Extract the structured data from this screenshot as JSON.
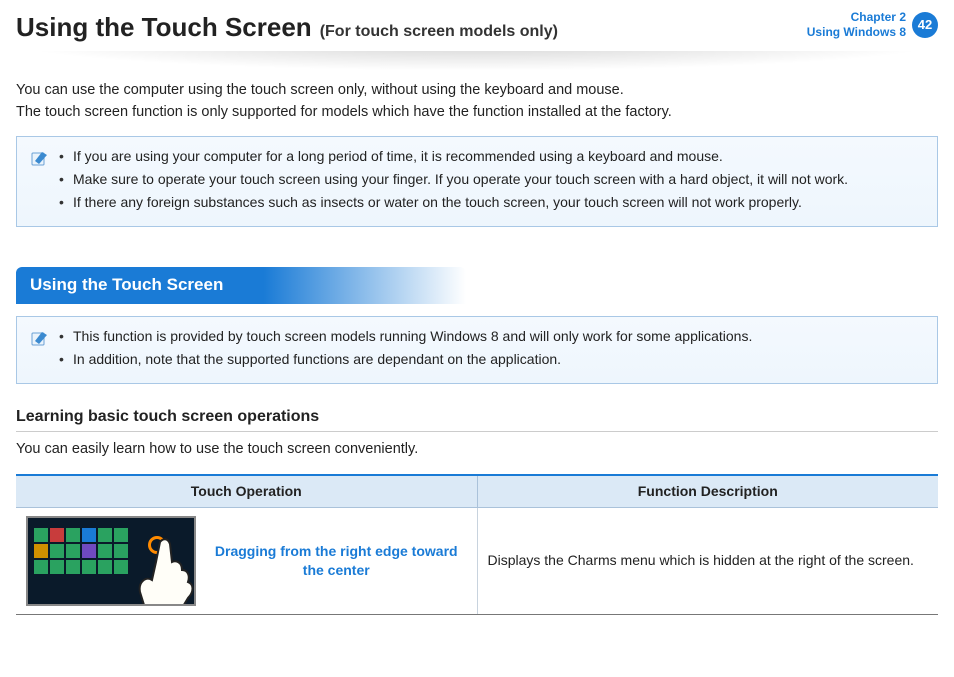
{
  "header": {
    "title": "Using the Touch Screen",
    "subtitle": "(For touch screen models only)",
    "chapter_line1": "Chapter 2",
    "chapter_line2": "Using Windows 8",
    "page_number": "42"
  },
  "intro": {
    "line1": "You can use the computer using the touch screen only, without using the keyboard and mouse.",
    "line2": "The touch screen function is only supported for models which have the function installed at the factory."
  },
  "note1": {
    "items": [
      "If you are using your computer for a long period of time, it is recommended using a keyboard and mouse.",
      "Make sure to operate your touch screen using your finger. If you operate your touch screen with a hard object, it will not work.",
      "If there any foreign substances such as insects or water on the touch screen, your touch screen will not work properly."
    ]
  },
  "section_heading": "Using the Touch Screen",
  "note2": {
    "items": [
      "This function is provided by touch screen models running Windows 8 and will only work for some applications.",
      "In addition, note that the supported functions are dependant on the application."
    ]
  },
  "sub_heading": "Learning basic touch screen operations",
  "sub_intro": "You can easily learn how to use the touch screen conveniently.",
  "table": {
    "col1": "Touch Operation",
    "col2": "Function Description",
    "row1_operation": "Dragging from the right edge toward the center",
    "row1_description": "Displays the Charms menu which is hidden at the right of the screen."
  }
}
